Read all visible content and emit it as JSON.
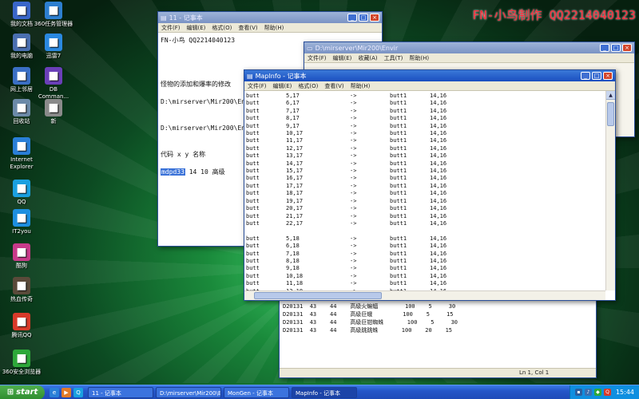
{
  "watermark": "FN-小鸟制作 QQ2214040123",
  "desktop_icons": [
    {
      "label": "我的文档",
      "icon": "folder-icon",
      "color": "#3a66c9"
    },
    {
      "label": "360任务管理器",
      "icon": "monitor-icon",
      "color": "#2d7fd0"
    },
    {
      "label": "我的电脑",
      "icon": "computer-icon",
      "color": "#4a6fb0"
    },
    {
      "label": "迅雷7",
      "icon": "thunder-icon",
      "color": "#2a88e0"
    },
    {
      "label": "网上邻居",
      "icon": "network-icon",
      "color": "#3b6fc5"
    },
    {
      "label": "DB Comman...",
      "icon": "db-icon",
      "color": "#6a3fb8"
    },
    {
      "label": "回收站",
      "icon": "recycle-bin-icon",
      "color": "#6c8aa8"
    },
    {
      "label": "新",
      "icon": "document-icon",
      "color": "#8a8a8a"
    },
    {
      "label": "Internet Explorer",
      "icon": "ie-icon",
      "color": "#2a7fd8"
    },
    {
      "label": "QQ",
      "icon": "qq-icon",
      "color": "#1aa0e0"
    },
    {
      "label": "IT2you",
      "icon": "app-icon",
      "color": "#1d8fe0"
    },
    {
      "label": "酷狗",
      "icon": "kugou-icon",
      "color": "#c83a8a"
    },
    {
      "label": "热血传奇",
      "icon": "game-icon",
      "color": "#5a4a3a"
    },
    {
      "label": "腾讯QQ",
      "icon": "penguin-icon",
      "color": "#d83a2a"
    },
    {
      "label": "360安全浏览器",
      "icon": "browser-icon",
      "color": "#2ea83a"
    }
  ],
  "win1": {
    "title": "11 - 记事本",
    "menu": [
      "文件(F)",
      "编辑(E)",
      "格式(O)",
      "查看(V)",
      "帮助(H)"
    ],
    "lines": [
      "FN-小鸟  QQ2214040123",
      "",
      "",
      "",
      "",
      "怪物的添加和爆率的修改",
      "",
      "D:\\mirserver\\Mir200\\Envi",
      "",
      "",
      "D:\\mirserver\\Mir200\\Envi",
      "",
      "",
      "代码   x    y     名称",
      ""
    ],
    "code_value": "mdpd33",
    "code_rest": " 14  10   高级"
  },
  "win2": {
    "title": "D:\\mirserver\\Mir200\\Envir",
    "menu": [
      "文件(F)",
      "编辑(E)",
      "收藏(A)",
      "工具(T)",
      "帮助(H)"
    ]
  },
  "mapinfo": {
    "title": "MapInfo - 记事本",
    "menu": [
      "文件(F)",
      "编辑(E)",
      "格式(O)",
      "查看(V)",
      "帮助(H)"
    ],
    "rows": [
      [
        "butt",
        "5,17",
        "->",
        "butt1",
        "14,16"
      ],
      [
        "butt",
        "6,17",
        "->",
        "butt1",
        "14,16"
      ],
      [
        "butt",
        "7,17",
        "->",
        "butt1",
        "14,16"
      ],
      [
        "butt",
        "8,17",
        "->",
        "butt1",
        "14,16"
      ],
      [
        "butt",
        "9,17",
        "->",
        "butt1",
        "14,16"
      ],
      [
        "butt",
        "10,17",
        "->",
        "butt1",
        "14,16"
      ],
      [
        "butt",
        "11,17",
        "->",
        "butt1",
        "14,16"
      ],
      [
        "butt",
        "12,17",
        "->",
        "butt1",
        "14,16"
      ],
      [
        "butt",
        "13,17",
        "->",
        "butt1",
        "14,16"
      ],
      [
        "butt",
        "14,17",
        "->",
        "butt1",
        "14,16"
      ],
      [
        "butt",
        "15,17",
        "->",
        "butt1",
        "14,16"
      ],
      [
        "butt",
        "16,17",
        "->",
        "butt1",
        "14,16"
      ],
      [
        "butt",
        "17,17",
        "->",
        "butt1",
        "14,16"
      ],
      [
        "butt",
        "18,17",
        "->",
        "butt1",
        "14,16"
      ],
      [
        "butt",
        "19,17",
        "->",
        "butt1",
        "14,16"
      ],
      [
        "butt",
        "20,17",
        "->",
        "butt1",
        "14,16"
      ],
      [
        "butt",
        "21,17",
        "->",
        "butt1",
        "14,16"
      ],
      [
        "butt",
        "22,17",
        "->",
        "butt1",
        "14,16"
      ],
      [
        "",
        "",
        "",
        "",
        ""
      ],
      [
        "butt",
        "5,18",
        "->",
        "butt1",
        "14,16"
      ],
      [
        "butt",
        "6,18",
        "->",
        "butt1",
        "14,16"
      ],
      [
        "butt",
        "7,18",
        "->",
        "butt1",
        "14,16"
      ],
      [
        "butt",
        "8,18",
        "->",
        "butt1",
        "14,16"
      ],
      [
        "butt",
        "9,18",
        "->",
        "butt1",
        "14,16"
      ],
      [
        "butt",
        "10,18",
        "->",
        "butt1",
        "14,16"
      ],
      [
        "butt",
        "11,18",
        "->",
        "butt1",
        "14,16"
      ],
      [
        "butt",
        "12,18",
        "->",
        "butt1",
        "14,16"
      ],
      [
        "butt",
        "13,18",
        "->",
        "butt1",
        "14,16"
      ]
    ]
  },
  "win3": {
    "rows": [
      "D20131  43    44    高级火蝙蝠        100    5     30",
      "D20131  43    44    高级巨蛾         100    5     15",
      "D20131  43    44    高级巨钳蜘蛛       100    5     30",
      "D20131  43    44    高级跳跳蛛       100    20    15"
    ],
    "status": "Ln 1, Col 1"
  },
  "taskbar": {
    "start_label": "start",
    "tasks": [
      "11 - 记事本",
      "D:\\mirserver\\Mir200\\E",
      "MonGen - 记事本",
      "MapInfo - 记事本"
    ],
    "active_task": 3,
    "clock": "15:44"
  }
}
